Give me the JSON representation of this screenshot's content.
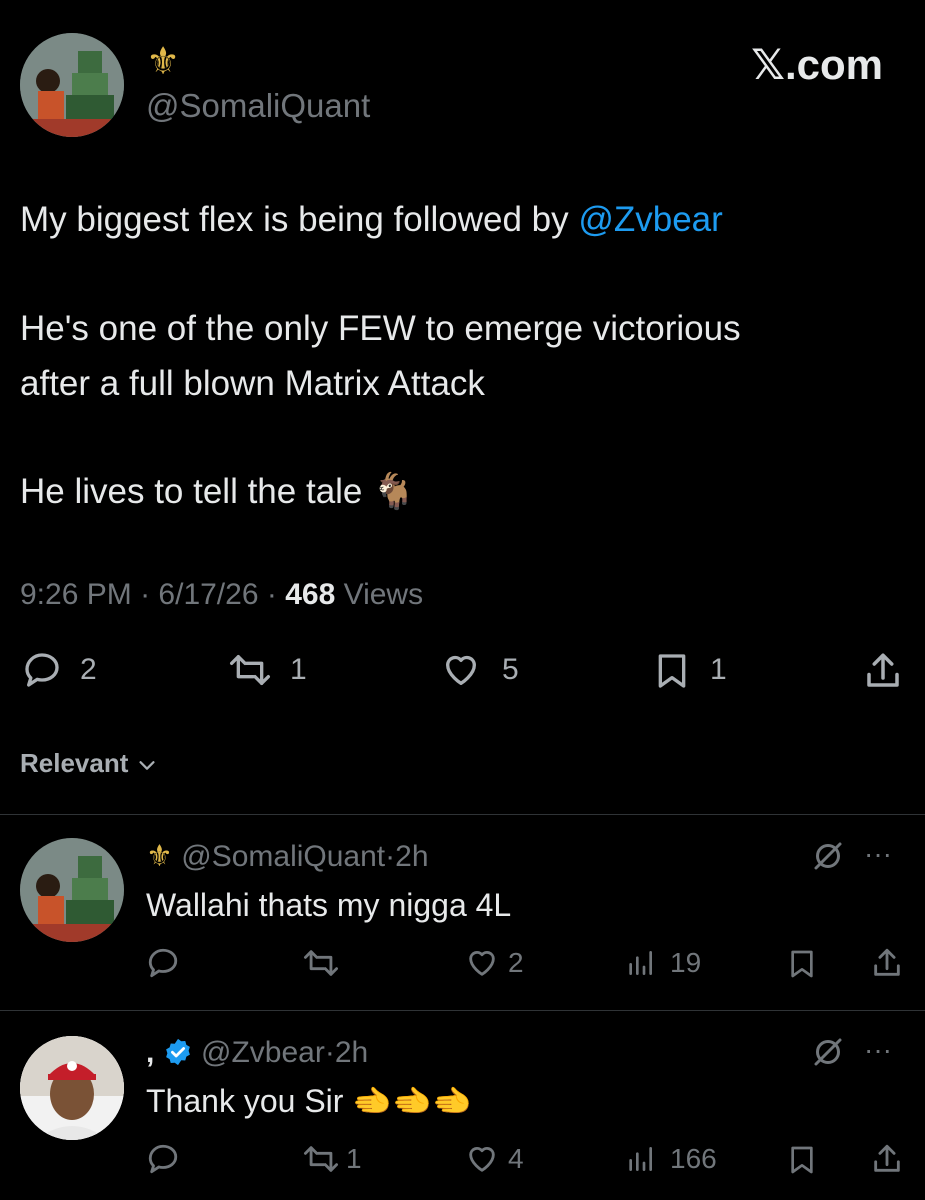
{
  "header": {
    "display_name_glyph": "⚜",
    "handle": "@SomaliQuant",
    "brand": "𝕏.com"
  },
  "tweet": {
    "line1_prefix": "My biggest flex is being followed by ",
    "line1_mention": "@Zvbear",
    "line2": "He's one of the only FEW to emerge victorious",
    "line3": "after a full blown Matrix Attack",
    "line4": "He lives to tell the tale",
    "line4_emoji": "🐐",
    "time": "9:26 PM",
    "sep": "·",
    "date": "6/17/26",
    "views_count": "468",
    "views_label": "Views",
    "replies": "2",
    "reposts": "1",
    "likes": "5",
    "bookmarks": "1"
  },
  "sort": {
    "label": "Relevant",
    "chevron": "⌄"
  },
  "replies": [
    {
      "name_glyph": "⚜",
      "handle": "@SomaliQuant",
      "sep": "·",
      "age": "2h",
      "text": "Wallahi thats my nigga 4L",
      "reposts": "",
      "likes": "2",
      "views": "19"
    },
    {
      "name_glyph": ",",
      "handle": "@Zvbear",
      "sep": "·",
      "age": "2h",
      "text": "Thank you Sir",
      "text_emoji": "🫲🫲🫲",
      "reposts": "1",
      "likes": "4",
      "views": "166"
    }
  ],
  "colors": {
    "background": "#000000",
    "text": "#e7e9ea",
    "muted": "#71767b",
    "link": "#1d9bf0",
    "verified": "#1d9bf0"
  }
}
